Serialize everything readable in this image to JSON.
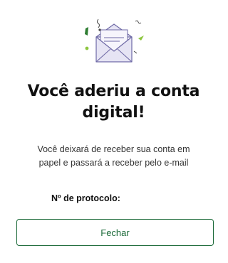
{
  "dialog": {
    "title_line1": "Você aderiu a conta",
    "title_line2": "digital!",
    "subtitle_line1": "Você deixará de receber sua conta em",
    "subtitle_line2": "papel e passará a receber pelo e-mail",
    "protocol_label": "Nº de protocolo:",
    "protocol_value": "",
    "close_label": "Fechar"
  },
  "colors": {
    "accent": "#1d6b3a",
    "envelope_fill": "#e6e4f4",
    "envelope_stroke": "#6f6aa6",
    "confetti_green": "#8dc63f",
    "confetti_dark_green": "#2e7d32"
  },
  "icons": {
    "illustration": "open-envelope-icon"
  }
}
